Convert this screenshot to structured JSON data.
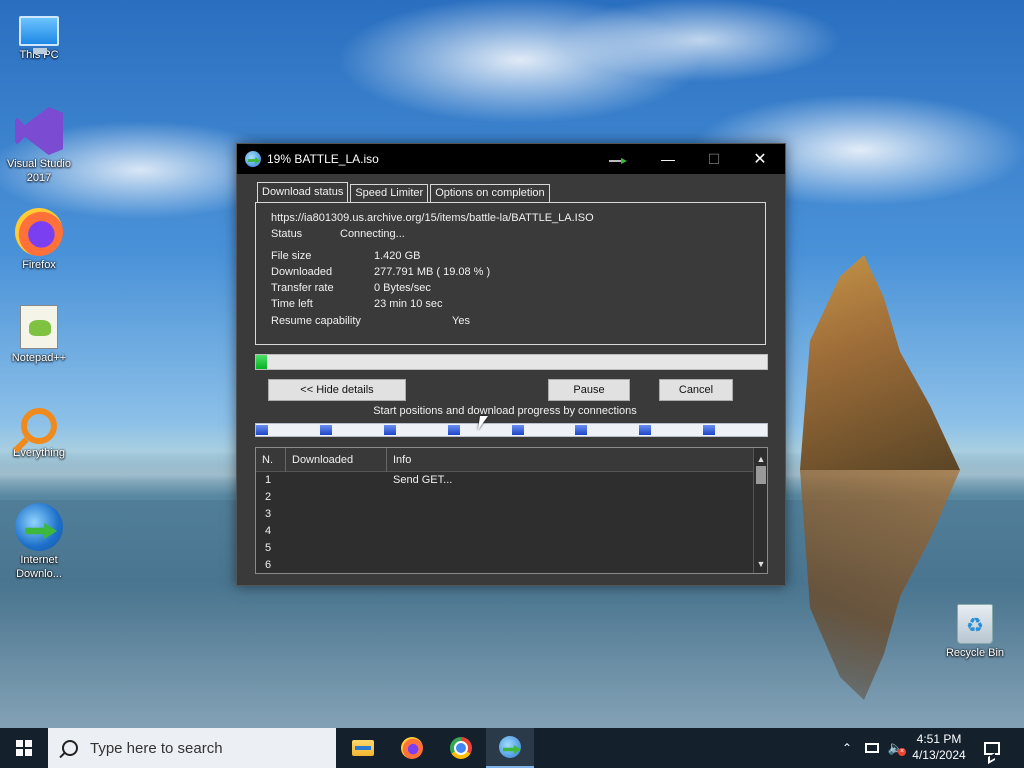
{
  "desktop": {
    "icons": [
      {
        "label": "This PC",
        "icon": "this-pc-icon"
      },
      {
        "label": "Visual Studio 2017",
        "icon": "visual-studio-icon"
      },
      {
        "label": "Firefox",
        "icon": "firefox-icon"
      },
      {
        "label": "Notepad++",
        "icon": "notepad-plus-plus-icon"
      },
      {
        "label": "Everything",
        "icon": "everything-search-icon"
      },
      {
        "label": "Internet Downlo...",
        "icon": "internet-download-manager-icon"
      },
      {
        "label": "Recycle Bin",
        "icon": "recycle-bin-icon"
      }
    ]
  },
  "window": {
    "title": "19% BATTLE_LA.iso",
    "tabs": [
      "Download status",
      "Speed Limiter",
      "Options on completion"
    ],
    "active_tab": 0,
    "url": "https://ia801309.us.archive.org/15/items/battle-la/BATTLE_LA.ISO",
    "status": {
      "label": "Status",
      "value": "Connecting..."
    },
    "details": {
      "file_size": {
        "label": "File size",
        "value": "1.420  GB"
      },
      "downloaded": {
        "label": "Downloaded",
        "value": "277.791  MB  ( 19.08 % )"
      },
      "transfer_rate": {
        "label": "Transfer rate",
        "value": "0  Bytes/sec"
      },
      "time_left": {
        "label": "Time left",
        "value": "23 min 10 sec"
      },
      "resume": {
        "label": "Resume capability",
        "value": "Yes"
      }
    },
    "progress_fraction": 0.0208,
    "buttons": {
      "hide_details": "<< Hide details",
      "pause": "Pause",
      "cancel": "Cancel"
    },
    "connections_caption": "Start positions and download progress by connections",
    "connection_starts": [
      0.0,
      0.125,
      0.25,
      0.375,
      0.5,
      0.625,
      0.75,
      0.875
    ],
    "table": {
      "headers": [
        "N.",
        "Downloaded",
        "Info"
      ],
      "rows": [
        {
          "n": "1",
          "downloaded": "",
          "info": "Send GET..."
        },
        {
          "n": "2",
          "downloaded": "",
          "info": ""
        },
        {
          "n": "3",
          "downloaded": "",
          "info": ""
        },
        {
          "n": "4",
          "downloaded": "",
          "info": ""
        },
        {
          "n": "5",
          "downloaded": "",
          "info": ""
        },
        {
          "n": "6",
          "downloaded": "",
          "info": ""
        }
      ]
    }
  },
  "taskbar": {
    "search_placeholder": "Type here to search",
    "apps": [
      "file-explorer-icon",
      "firefox-icon",
      "chrome-icon",
      "internet-download-manager-icon"
    ],
    "active_app": 3,
    "time": "4:51 PM",
    "date": "4/13/2024"
  },
  "colors": {
    "progress_green": "#06b025",
    "connection_blue": "#1c44c9",
    "taskbar_bg": "#14202c"
  }
}
